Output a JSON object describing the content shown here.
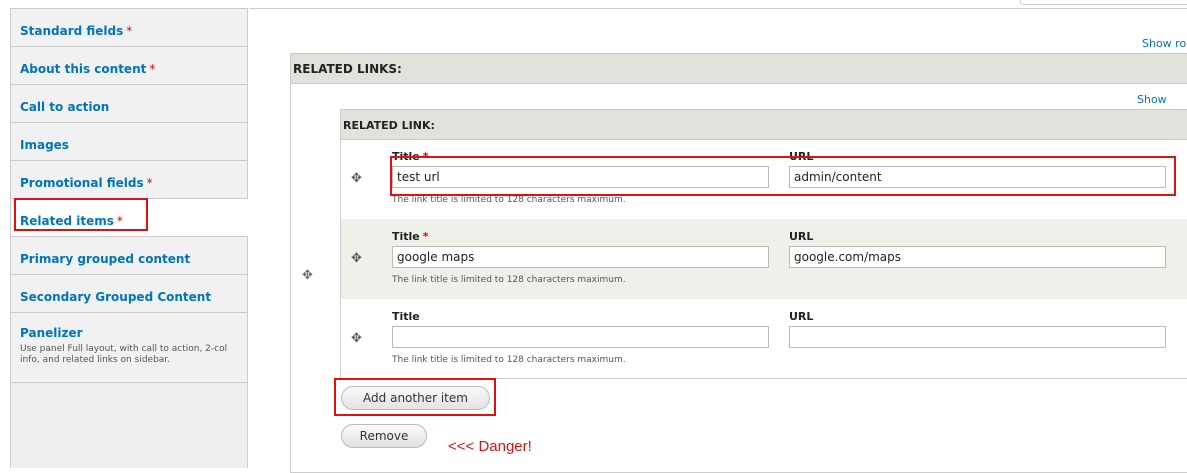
{
  "sidebar": {
    "tabs": [
      {
        "label": "Standard fields",
        "required": "*"
      },
      {
        "label": "About this content",
        "required": "*"
      },
      {
        "label": "Call to action",
        "required": ""
      },
      {
        "label": "Images",
        "required": ""
      },
      {
        "label": "Promotional fields",
        "required": "*"
      },
      {
        "label": "Related items",
        "required": "*"
      },
      {
        "label": "Primary grouped content",
        "required": ""
      },
      {
        "label": "Secondary Grouped Content",
        "required": ""
      },
      {
        "label": "Panelizer",
        "required": "",
        "summary": "Use panel Full layout, with call to action, 2-col info, and related links on sidebar."
      }
    ],
    "active_tab": "Related items"
  },
  "related_links": {
    "heading": "RELATED LINKS:",
    "show_row_weights": "Show ro",
    "inner_heading": "RELATED LINK:",
    "inner_show_row_weights": "Show row",
    "title_label": "Title",
    "url_label": "URL",
    "required_marker": "*",
    "help_text": "The link title is limited to 128 characters maximum.",
    "rows": [
      {
        "title": "test url",
        "url": "admin/content",
        "title_required": true
      },
      {
        "title": "google maps",
        "url": "google.com/maps",
        "title_required": true
      },
      {
        "title": "",
        "url": "",
        "title_required": false
      }
    ],
    "add_button": "Add another item",
    "remove_button": "Remove"
  },
  "annotation": {
    "text": "<<< Danger!",
    "color": "#dd1111"
  },
  "icons": {
    "drag_handle": "move-cross-icon"
  }
}
